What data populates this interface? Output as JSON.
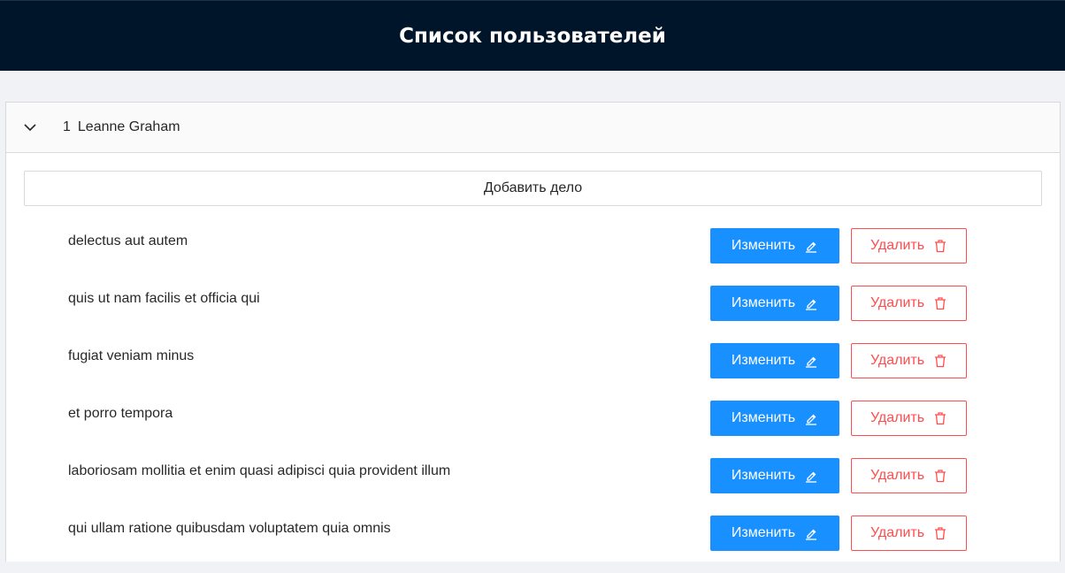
{
  "header": {
    "title": "Список пользователей"
  },
  "user": {
    "id": "1",
    "name": "Leanne Graham",
    "expanded": true
  },
  "actions": {
    "add_label": "Добавить дело",
    "edit_label": "Изменить",
    "delete_label": "Удалить"
  },
  "todos": [
    {
      "title": "delectus aut autem"
    },
    {
      "title": "quis ut nam facilis et officia qui"
    },
    {
      "title": "fugiat veniam minus"
    },
    {
      "title": "et porro tempora"
    },
    {
      "title": "laboriosam mollitia et enim quasi adipisci quia provident illum"
    },
    {
      "title": "qui ullam ratione quibusdam voluptatem quia omnis"
    }
  ],
  "icons": {
    "expand": "chevron-down-icon",
    "edit": "edit-icon",
    "delete": "trash-icon"
  },
  "colors": {
    "header_bg": "#001529",
    "primary": "#1890ff",
    "danger": "#ff4d4f",
    "page_bg": "#f0f2f5"
  }
}
